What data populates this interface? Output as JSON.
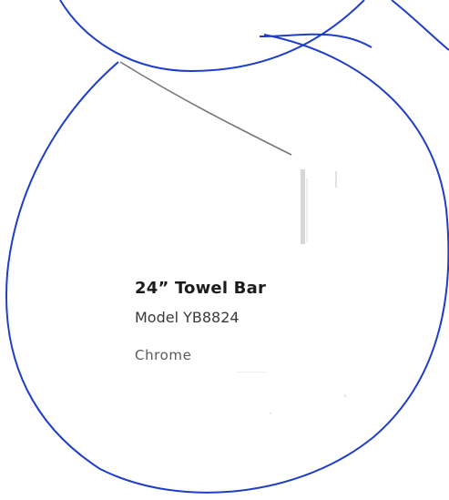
{
  "spec_sheet": {
    "product_name": "24” Towel Bar",
    "model": "Model YB8824",
    "finish": "Chrome"
  },
  "colors": {
    "ink_circles": "#1f3fc4",
    "leader_line": "#777777",
    "text_dark": "#1c1c1c",
    "text_mid": "#3a3a3a",
    "text_light": "#5a5a5a"
  }
}
